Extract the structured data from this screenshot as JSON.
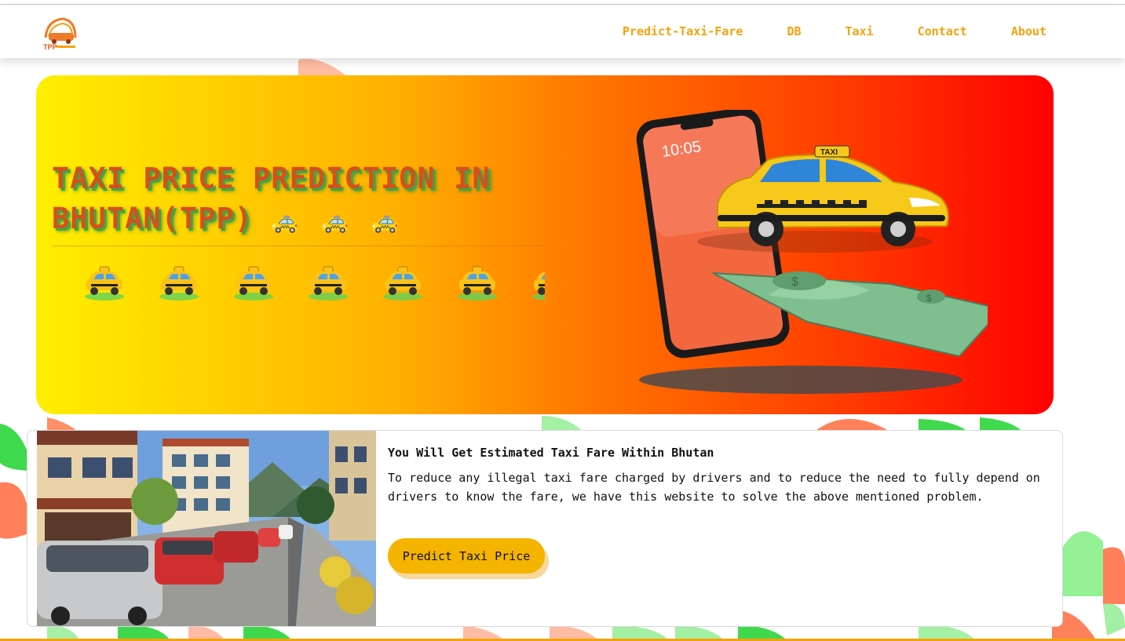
{
  "brand": {
    "logo_icon": "tpp-taxi-logo-icon",
    "logo_text": "TPP"
  },
  "nav": {
    "items": [
      {
        "label": "Predict-Taxi-Fare"
      },
      {
        "label": "DB"
      },
      {
        "label": "Taxi"
      },
      {
        "label": "Contact"
      },
      {
        "label": "About"
      }
    ]
  },
  "hero": {
    "title": "TAXI PRICE PREDICTION IN BHUTAN(TPP)",
    "title_emojis": "🚕 🚕 🚕",
    "marquee_icon": "taxi-emoji-icon",
    "illustration_icon": "phone-taxi-cash-illustration",
    "phone_time": "10:05",
    "taxi_sign": "TAXI"
  },
  "info": {
    "title": "You Will Get Estimated Taxi Fare Within Bhutan",
    "text": "To reduce any illegal taxi fare charged by drivers and to reduce the need to fully depend on drivers to know the fare, we have this website to solve the above mentioned problem.",
    "button_label": "Predict Taxi Price",
    "photo_icon": "thimphu-taxi-street-photo"
  },
  "colors": {
    "accent": "#f4a20a",
    "button": "#f4b400",
    "hero_start": "#ffef00",
    "hero_end": "#ff0000",
    "title_text": "#d4511b",
    "title_shadow": "#3fa64a"
  }
}
